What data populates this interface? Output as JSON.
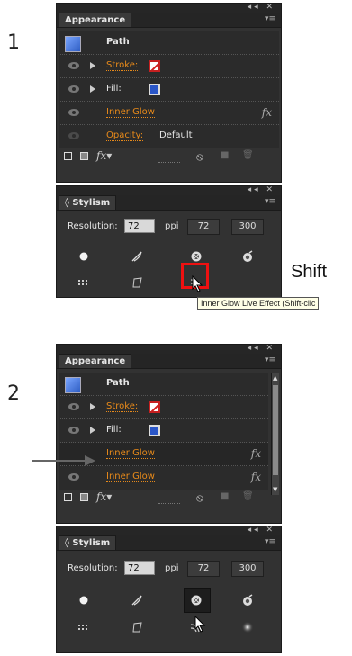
{
  "steps": {
    "one": "1",
    "two": "2"
  },
  "appearance": {
    "tab": "Appearance",
    "object": "Path",
    "stroke_label": "Stroke:",
    "fill_label": "Fill:",
    "inner_glow": "Inner Glow",
    "opacity_label": "Opacity:",
    "opacity_value": "Default",
    "fx": "fx"
  },
  "stylism": {
    "tab": "◊ Stylism",
    "resolution_label": "Resolution:",
    "res_value": "72",
    "ppi": "ppi",
    "btn72": "72",
    "btn300": "300"
  },
  "tooltip": "Inner Glow Live Effect (Shift-clic",
  "shift": "Shift",
  "panel_controls": "◂◂ ✕",
  "icons": [
    "eye-icon",
    "disclosure-triangle-icon",
    "fx-icon",
    "new-layer-icon",
    "clear-icon",
    "delete-icon"
  ],
  "colors": {
    "accent_orange": "#e88a1a",
    "highlight_red": "#e11111",
    "fill_blue": "#2a56c8"
  }
}
